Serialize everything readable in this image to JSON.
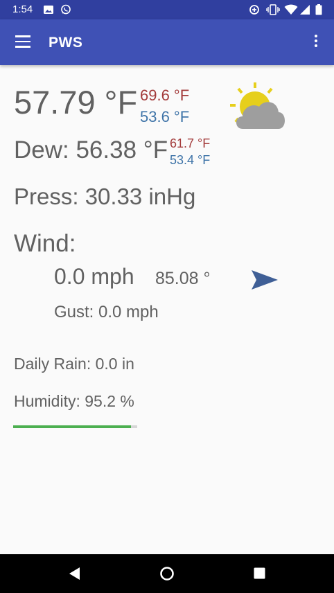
{
  "status_bar": {
    "time": "1:54",
    "left_icons": [
      "image-icon",
      "whatsapp-icon"
    ],
    "right_icons": [
      "data-saver-icon",
      "vibrate-icon",
      "wifi-icon",
      "signal-icon",
      "battery-icon"
    ]
  },
  "app_bar": {
    "title": "PWS",
    "menu_icon": "hamburger-menu-icon",
    "overflow_icon": "overflow-menu-icon",
    "color": "#3f51b5",
    "status_color": "#303f9f"
  },
  "weather": {
    "temperature": "57.79 °F",
    "temp_high": "69.6 °F",
    "temp_low": "53.6 °F",
    "condition_icon": "partly-cloudy-icon",
    "dew": "Dew: 56.38 °F",
    "dew_high": "61.7 °F",
    "dew_low": "53.4 °F",
    "pressure": "Press: 30.33 inHg",
    "wind_label": "Wind:",
    "wind_speed": "0.0 mph",
    "wind_direction": "85.08 °",
    "wind_direction_deg": 85.08,
    "gust": "Gust: 0.0 mph",
    "daily_rain": "Daily Rain: 0.0 in",
    "humidity": "Humidity: 95.2 %",
    "humidity_value": 95.2,
    "high_color": "#a33b3b",
    "low_color": "#3f74a8",
    "progress_color": "#4caf50"
  },
  "nav_bar": {
    "icons": [
      "back-icon",
      "home-icon",
      "recent-apps-icon"
    ]
  }
}
